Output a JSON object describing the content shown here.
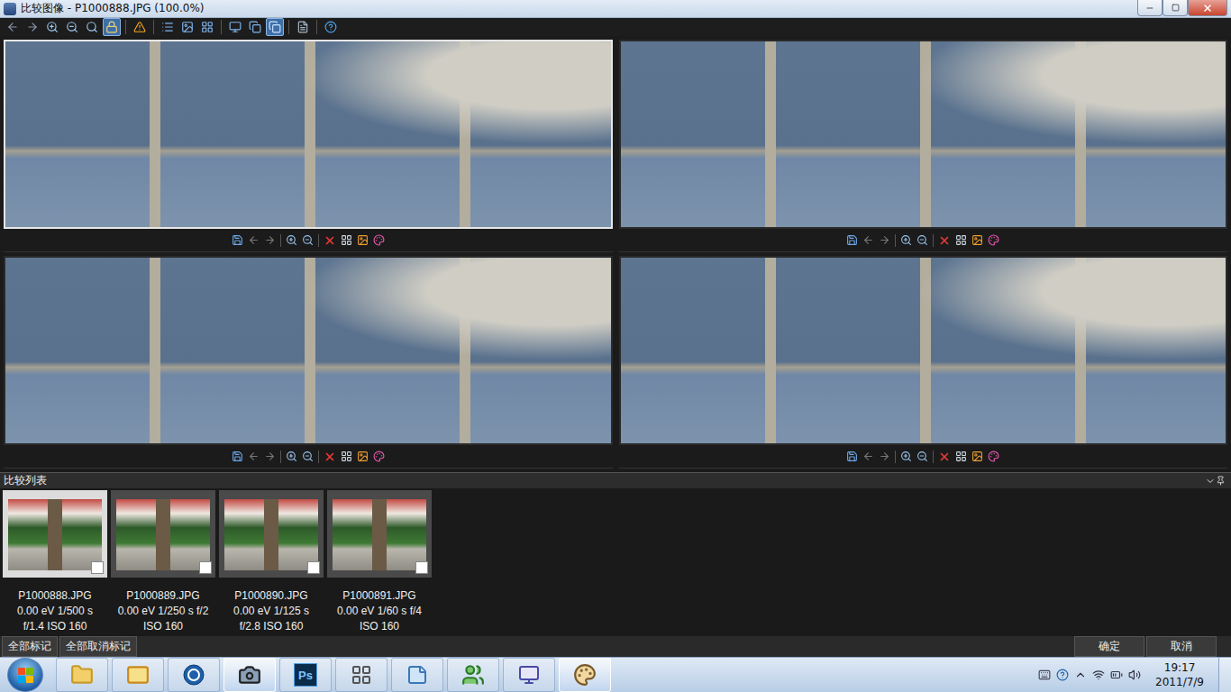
{
  "window": {
    "title": "比较图像 - P1000888.JPG (100.0%)"
  },
  "toolbar": {
    "buttons": [
      {
        "selected": false
      },
      {
        "selected": false
      },
      {
        "selected": false
      },
      {
        "selected": false
      },
      {
        "selected": false
      },
      {
        "selected": true
      },
      {
        "selected": false
      },
      {
        "selected": false
      },
      {
        "selected": false
      },
      {
        "selected": false
      },
      {
        "selected": false
      },
      {
        "selected": false
      },
      {
        "selected": true
      },
      {
        "selected": false
      },
      {
        "selected": false
      }
    ]
  },
  "panels": [
    {
      "selected": true
    },
    {
      "selected": false
    },
    {
      "selected": false
    },
    {
      "selected": false
    }
  ],
  "compare_list": {
    "title": "比较列表",
    "items": [
      {
        "file": "P1000888.JPG",
        "lines": [
          "0.00 eV 1/500 s",
          "f/1.4 ISO 160"
        ],
        "selected": true,
        "checked": false
      },
      {
        "file": "P1000889.JPG",
        "lines": [
          "0.00 eV 1/250 s f/2",
          "ISO 160"
        ],
        "selected": false,
        "checked": false
      },
      {
        "file": "P1000890.JPG",
        "lines": [
          "0.00 eV 1/125 s",
          "f/2.8 ISO 160"
        ],
        "selected": false,
        "checked": false
      },
      {
        "file": "P1000891.JPG",
        "lines": [
          "0.00 eV 1/60 s f/4",
          "ISO 160"
        ],
        "selected": false,
        "checked": false
      }
    ]
  },
  "footer": {
    "left_buttons": [
      "全部标记",
      "全部取消标记"
    ],
    "right_buttons": [
      "确定",
      "取消"
    ]
  },
  "taskbar": {
    "apps": [
      {
        "kind": "folder",
        "glyph": "",
        "active": false
      },
      {
        "kind": "mail",
        "glyph": "",
        "active": false
      },
      {
        "kind": "browser",
        "glyph": "",
        "active": false
      },
      {
        "kind": "camera",
        "glyph": "",
        "active": true
      },
      {
        "kind": "ps",
        "glyph": "Ps",
        "active": false
      },
      {
        "kind": "grid",
        "glyph": "",
        "active": false
      },
      {
        "kind": "note",
        "glyph": "",
        "active": false
      },
      {
        "kind": "people",
        "glyph": "",
        "active": false
      },
      {
        "kind": "viewer",
        "glyph": "",
        "active": false
      },
      {
        "kind": "paint",
        "glyph": "",
        "active": true
      }
    ],
    "clock": {
      "time": "19:17",
      "date": "2011/7/9"
    }
  }
}
